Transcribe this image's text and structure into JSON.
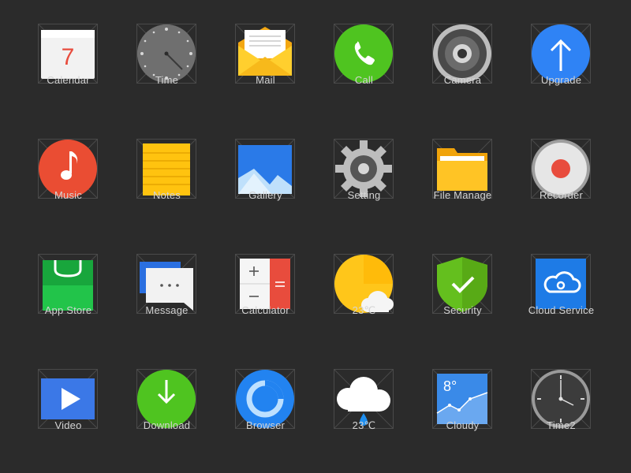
{
  "apps": [
    {
      "label": "Calendar",
      "icon": "calendar-icon",
      "value": "7"
    },
    {
      "label": "Time",
      "icon": "clock-icon"
    },
    {
      "label": "Mail",
      "icon": "mail-icon"
    },
    {
      "label": "Call",
      "icon": "phone-icon"
    },
    {
      "label": "Camera",
      "icon": "camera-icon"
    },
    {
      "label": "Upgrade",
      "icon": "upgrade-arrow-icon"
    },
    {
      "label": "Music",
      "icon": "music-note-icon"
    },
    {
      "label": "Notes",
      "icon": "notes-icon"
    },
    {
      "label": "Gallery",
      "icon": "gallery-mountain-icon"
    },
    {
      "label": "Setting",
      "icon": "gear-icon"
    },
    {
      "label": "File Manage",
      "icon": "folder-icon"
    },
    {
      "label": "Recorder",
      "icon": "record-icon"
    },
    {
      "label": "App Store",
      "icon": "shopping-bag-icon"
    },
    {
      "label": "Message",
      "icon": "chat-bubble-icon"
    },
    {
      "label": "Calculator",
      "icon": "calculator-icon"
    },
    {
      "label": "23℃",
      "icon": "weather-sun-cloud-icon"
    },
    {
      "label": "Security",
      "icon": "shield-check-icon"
    },
    {
      "label": "Cloud Service",
      "icon": "cloud-service-icon"
    },
    {
      "label": "Video",
      "icon": "play-icon"
    },
    {
      "label": "Download",
      "icon": "download-arrow-icon"
    },
    {
      "label": "Browser",
      "icon": "browser-ring-icon"
    },
    {
      "label": "23℃",
      "icon": "weather-rain-cloud-icon"
    },
    {
      "label": "Cloudy",
      "icon": "weather-chart-icon",
      "value": "8°"
    },
    {
      "label": "Time2",
      "icon": "clock-dark-icon"
    }
  ],
  "colors": {
    "background": "#2b2b2b",
    "guide": "#4a4a4a",
    "label": "#d4d4d4"
  }
}
